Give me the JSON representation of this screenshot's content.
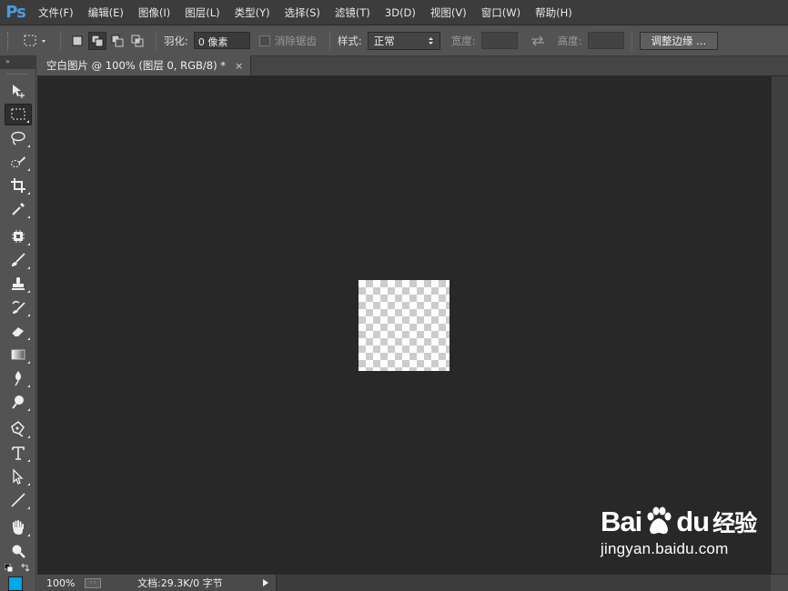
{
  "app": {
    "logo": "Ps"
  },
  "menu": [
    {
      "label": "文件(F)"
    },
    {
      "label": "编辑(E)"
    },
    {
      "label": "图像(I)"
    },
    {
      "label": "图层(L)"
    },
    {
      "label": "类型(Y)"
    },
    {
      "label": "选择(S)"
    },
    {
      "label": "滤镜(T)"
    },
    {
      "label": "3D(D)"
    },
    {
      "label": "视图(V)"
    },
    {
      "label": "窗口(W)"
    },
    {
      "label": "帮助(H)"
    }
  ],
  "options": {
    "feather_label": "羽化:",
    "feather_value": "0 像素",
    "antialias_label": "消除锯齿",
    "style_label": "样式:",
    "style_value": "正常",
    "width_label": "宽度:",
    "height_label": "高度:",
    "refine_button": "调整边缘 ..."
  },
  "toolbox": {
    "header": "»",
    "tools": [
      {
        "icon": "move-tool-icon"
      },
      {
        "icon": "rect-marquee-tool-icon"
      },
      {
        "icon": "lasso-tool-icon"
      },
      {
        "icon": "quick-selection-tool-icon"
      },
      {
        "icon": "crop-tool-icon"
      },
      {
        "icon": "eyedropper-tool-icon"
      },
      {
        "icon": "healing-brush-tool-icon"
      },
      {
        "icon": "brush-tool-icon"
      },
      {
        "icon": "clone-stamp-tool-icon"
      },
      {
        "icon": "history-brush-tool-icon"
      },
      {
        "icon": "eraser-tool-icon"
      },
      {
        "icon": "gradient-tool-icon"
      },
      {
        "icon": "blur-tool-icon"
      },
      {
        "icon": "dodge-tool-icon"
      },
      {
        "icon": "pen-tool-icon"
      },
      {
        "icon": "type-tool-icon"
      },
      {
        "icon": "path-selection-tool-icon"
      },
      {
        "icon": "line-tool-icon"
      },
      {
        "icon": "hand-tool-icon"
      },
      {
        "icon": "zoom-tool-icon"
      }
    ],
    "foreground_color": "#000000",
    "background_color": "#00a8e8"
  },
  "document": {
    "tab_title": "空白图片 @ 100% (图层 0, RGB/8) *",
    "tab_close": "×"
  },
  "status": {
    "zoom": "100%",
    "doc_info": "文档:29.3K/0 字节"
  },
  "watermark": {
    "brand_left": "Bai",
    "brand_right": "du",
    "brand_cn": "经验",
    "url": "jingyan.baidu.com"
  }
}
